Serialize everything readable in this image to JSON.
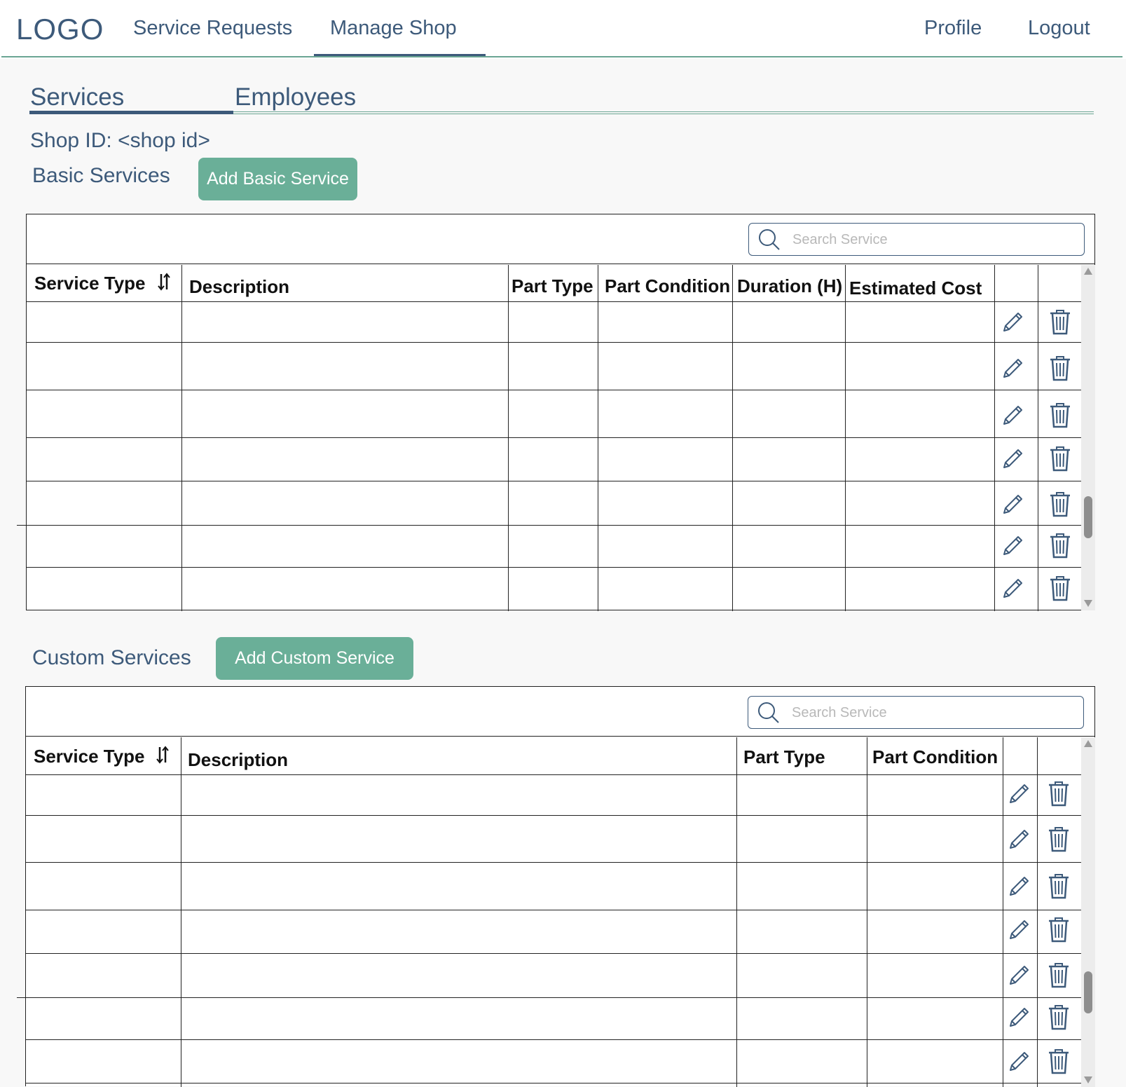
{
  "nav": {
    "logo": "LOGO",
    "links": [
      "Service Requests",
      "Manage Shop"
    ],
    "right_links": [
      "Profile",
      "Logout"
    ],
    "active": "Manage Shop"
  },
  "subtabs": {
    "items": [
      "Services",
      "Employees"
    ],
    "active": "Services"
  },
  "shop_id": "Shop ID: <shop id>",
  "basic": {
    "title": "Basic Services",
    "add_button": "Add Basic Service",
    "search_placeholder": "Search Service",
    "columns": [
      "Service Type",
      "Description",
      "Part Type",
      "Part Condition",
      "Duration (H)",
      "Estimated Cost"
    ],
    "row_count": 7
  },
  "custom": {
    "title": "Custom Services",
    "add_button": "Add Custom Service",
    "search_placeholder": "Search Service",
    "columns": [
      "Service Type",
      "Description",
      "Part Type",
      "Part Condition"
    ],
    "row_count": 7
  },
  "icons": {
    "edit": "pencil-icon",
    "delete": "trash-icon",
    "search": "search-icon",
    "sort": "sort-icon"
  },
  "colors": {
    "primary_text": "#3d5a7a",
    "accent_green": "#6aaf98",
    "divider_green": "#6aa593"
  }
}
